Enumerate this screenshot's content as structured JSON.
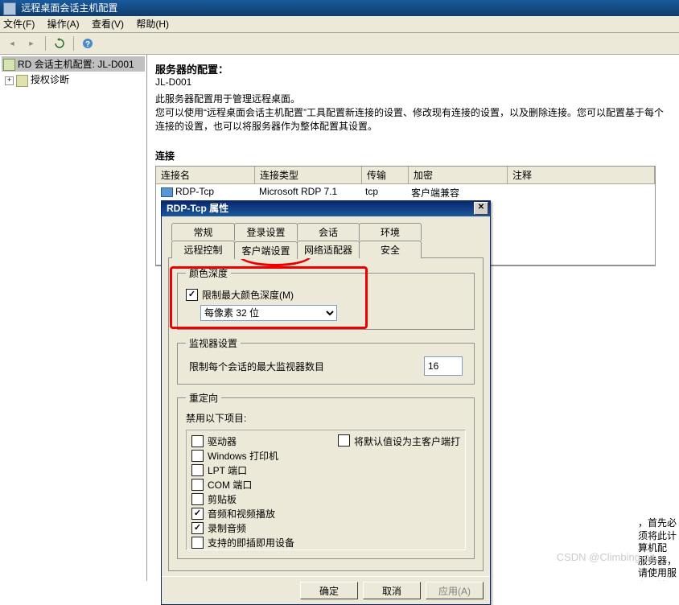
{
  "window": {
    "title": "远程桌面会话主机配置"
  },
  "menu": {
    "file": "文件(F)",
    "action": "操作(A)",
    "view": "查看(V)",
    "help": "帮助(H)"
  },
  "tree": {
    "root": "RD 会话主机配置: JL-D001",
    "child": "授权诊断"
  },
  "content": {
    "heading": "服务器的配置：",
    "hostname": "JL-D001",
    "desc1": "此服务器配置用于管理远程桌面。",
    "desc2": "您可以使用“远程桌面会话主机配置”工具配置新连接的设置、修改现有连接的设置，以及删除连接。您可以配置基于每个连接的设置，也可以将服务器作为整体配置其设置。",
    "conn_label": "连接"
  },
  "table": {
    "headers": {
      "name": "连接名",
      "type": "连接类型",
      "trans": "传输",
      "enc": "加密",
      "comm": "注释"
    },
    "row": {
      "name": "RDP-Tcp",
      "type": "Microsoft RDP 7.1",
      "trans": "tcp",
      "enc": "客户端兼容",
      "comm": ""
    }
  },
  "dialog": {
    "title": "RDP-Tcp 属性",
    "tabs_row1": [
      "常规",
      "登录设置",
      "会话",
      "环境"
    ],
    "tabs_row2": [
      "远程控制",
      "客户端设置",
      "网络适配器",
      "安全"
    ],
    "group_color": "颜色深度",
    "chk_maxcolor": "限制最大颜色深度(M)",
    "color_value": "每像素 32 位",
    "group_monitor": "监视器设置",
    "monitor_label": "限制每个会话的最大监视器数目",
    "monitor_value": "16",
    "group_redirect": "重定向",
    "redirect_label": "禁用以下项目:",
    "redir_items": [
      {
        "label": "驱动器",
        "checked": false
      },
      {
        "label": "Windows 打印机",
        "checked": false
      },
      {
        "label": "LPT 端口",
        "checked": false
      },
      {
        "label": "COM 端口",
        "checked": false
      },
      {
        "label": "剪贴板",
        "checked": false
      },
      {
        "label": "音频和视频播放",
        "checked": true
      },
      {
        "label": "录制音频",
        "checked": true
      },
      {
        "label": "支持的即插即用设备",
        "checked": false
      }
    ],
    "chk_default": "将默认值设为主客户端打",
    "btn_ok": "确定",
    "btn_cancel": "取消",
    "btn_apply": "应用(A)"
  },
  "side_note": "，首先必须将此计算机配\n服务器，请使用服务器管",
  "watermark": "CSDN @Climbing-pit"
}
